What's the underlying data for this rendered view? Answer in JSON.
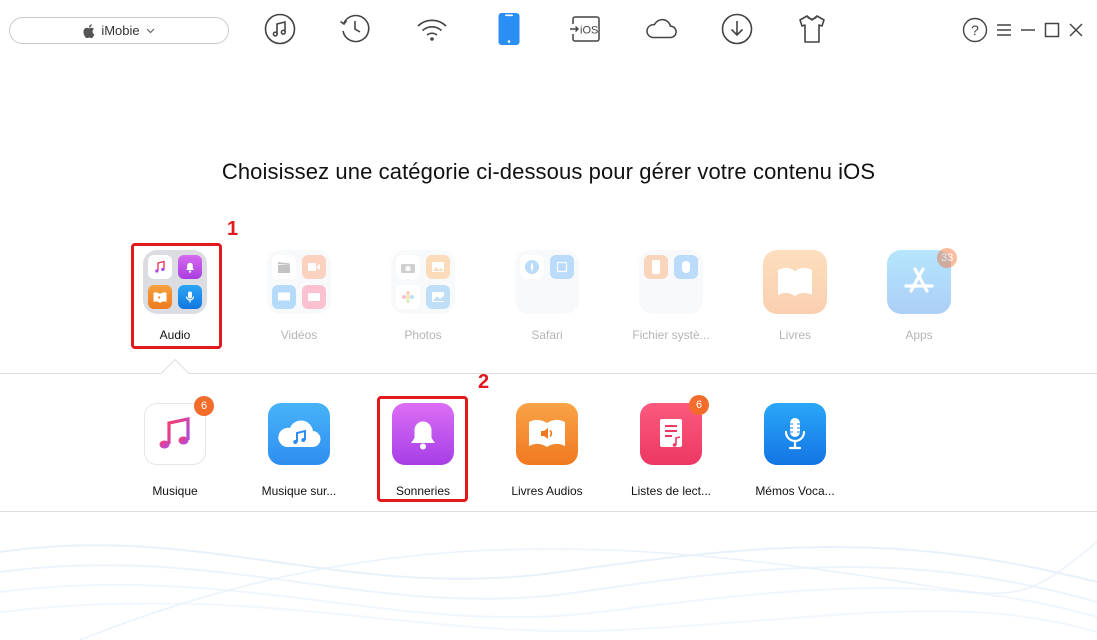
{
  "toolbar": {
    "device_name": "iMobie",
    "nav_icons": [
      "music-icon",
      "history-icon",
      "wifi-icon",
      "phone-icon",
      "ios-icon",
      "cloud-icon",
      "download-icon",
      "shirt-icon"
    ],
    "window_icons": [
      "help-icon",
      "menu-icon",
      "minimize-icon",
      "maximize-icon",
      "close-icon"
    ],
    "help_glyph": "?"
  },
  "main": {
    "heading": "Choisissez une catégorie ci-dessous pour gérer votre contenu iOS"
  },
  "categories": [
    {
      "label": "Audio",
      "active": true
    },
    {
      "label": "Vidéos"
    },
    {
      "label": "Photos"
    },
    {
      "label": "Safari"
    },
    {
      "label": "Fichier systè..."
    },
    {
      "label": "Livres"
    },
    {
      "label": "Apps",
      "badge": "33"
    }
  ],
  "subcategories": [
    {
      "label": "Musique",
      "badge": "6"
    },
    {
      "label": "Musique sur..."
    },
    {
      "label": "Sonneries"
    },
    {
      "label": "Livres Audios"
    },
    {
      "label": "Listes de lect...",
      "badge": "6"
    },
    {
      "label": "Mémos Voca..."
    }
  ],
  "annotations": {
    "step1": "1",
    "step2": "2"
  },
  "colors": {
    "accent_blue": "#2b8ef5",
    "annotation_red": "#e0191f",
    "badge_orange": "#f26c2b"
  }
}
